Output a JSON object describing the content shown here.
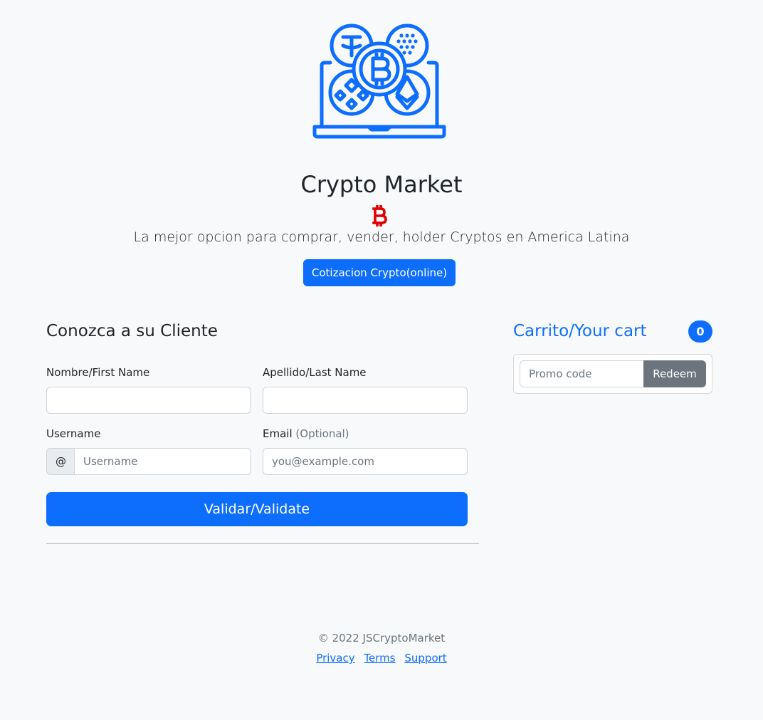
{
  "colors": {
    "primary": "#0d6efd",
    "secondary": "#6c757d",
    "bitcoin_red": "#e00000",
    "background": "#f8f9fa"
  },
  "hero": {
    "logo_icon": "laptop-crypto-coins-icon",
    "title": "Crypto Market",
    "symbol_icon": "bitcoin-icon",
    "lead": "La mejor opcion para comprar, vender, holder Cryptos en America Latina",
    "quote_button": "Cotizacion Crypto(online)"
  },
  "form": {
    "title": "Conozca a su Cliente",
    "first_name_label": "Nombre/First Name",
    "first_name_value": "",
    "last_name_label": "Apellido/Last Name",
    "last_name_value": "",
    "username_label": "Username",
    "username_prefix": "@",
    "username_placeholder": "Username",
    "email_label": "Email",
    "email_optional": "(Optional)",
    "email_placeholder": "you@example.com",
    "submit_label": "Validar/Validate"
  },
  "cart": {
    "title": "Carrito/Your cart",
    "count": "0",
    "promo_placeholder": "Promo code",
    "redeem_label": "Redeem"
  },
  "footer": {
    "copyright": "© 2022 JSCryptoMarket",
    "links": [
      "Privacy",
      "Terms",
      "Support"
    ]
  }
}
